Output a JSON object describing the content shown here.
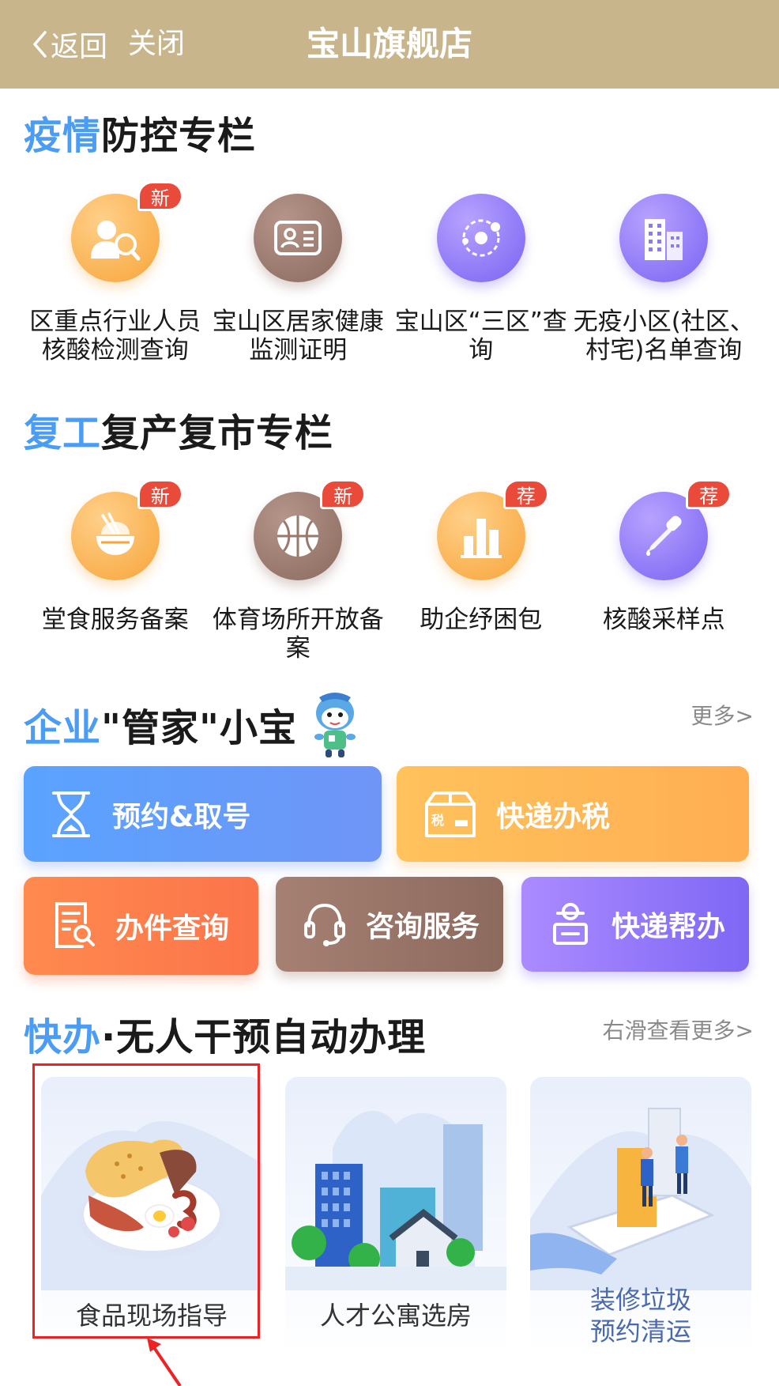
{
  "header": {
    "back_label": "返回",
    "close_label": "关闭",
    "title": "宝山旗舰店"
  },
  "section_epidemic": {
    "title_accent": "疫情",
    "title_rest": "防控专栏",
    "items": [
      {
        "label": "区重点行业人员核酸检测查询",
        "badge": "新",
        "icon": "doctor-search-icon",
        "color": "orange"
      },
      {
        "label": "宝山区居家健康监测证明",
        "badge": "",
        "icon": "id-card-icon",
        "color": "brown"
      },
      {
        "label": "宝山区“三区”查询",
        "badge": "",
        "icon": "orbit-icon",
        "color": "purple"
      },
      {
        "label": "无疫小区(社区、村宅)名单查询",
        "badge": "",
        "icon": "buildings-icon",
        "color": "purple"
      }
    ]
  },
  "section_resume": {
    "title_accent": "复工",
    "title_rest": "复产复市专栏",
    "items": [
      {
        "label": "堂食服务备案",
        "badge": "新",
        "icon": "food-bowl-icon",
        "color": "orange"
      },
      {
        "label": "体育场所开放备案",
        "badge": "新",
        "icon": "basketball-icon",
        "color": "brown"
      },
      {
        "label": "助企纾困包",
        "badge": "荐",
        "icon": "city-chart-icon",
        "color": "orange"
      },
      {
        "label": "核酸采样点",
        "badge": "荐",
        "icon": "dropper-icon",
        "color": "purple"
      }
    ]
  },
  "section_butler": {
    "title_accent": "企业",
    "title_rest": "\"管家\"小宝",
    "more": "更多>",
    "services": [
      {
        "label": "预约&取号",
        "icon": "hourglass-icon",
        "color": "blue"
      },
      {
        "label": "快递办税",
        "icon": "tax-box-icon",
        "color": "yellow"
      },
      {
        "label": "办件查询",
        "icon": "doc-search-icon",
        "color": "red"
      },
      {
        "label": "咨询服务",
        "icon": "headset-icon",
        "color": "brown"
      },
      {
        "label": "快递帮办",
        "icon": "courier-icon",
        "color": "purple"
      }
    ]
  },
  "section_quick": {
    "title_accent": "快办",
    "title_rest": "·无人干预自动办理",
    "more": "右滑查看更多>",
    "cards": [
      {
        "label": "食品现场指导",
        "icon": "breakfast-plate-icon"
      },
      {
        "label": "人才公寓选房",
        "icon": "apartment-buildings-icon"
      },
      {
        "label_line1": "装修垃圾",
        "label_line2": "预约清运",
        "icon": "renovation-phone-icon"
      }
    ]
  },
  "colors": {
    "header_bg": "#c8b58b",
    "accent_blue": "#4a9cf5",
    "badge_red": "#ea4a3a",
    "highlight_red": "#ee2222"
  }
}
